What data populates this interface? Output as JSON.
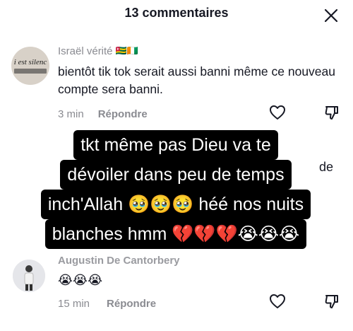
{
  "header": {
    "title": "13 commentaires",
    "close_icon": "close-icon"
  },
  "comments": [
    {
      "avatar_text": "i est silenc",
      "username": "Israël vérité",
      "flags": "🇹🇬🇨🇮",
      "text": "bientôt tik tok serait aussi banni même ce nouveau compte sera banni.",
      "time": "3 min",
      "reply_label": "Répondre"
    },
    {
      "username": "Augustin De Cantorbery",
      "text": "😭😭😭",
      "time": "15 min",
      "reply_label": "Répondre"
    }
  ],
  "hidden_snippet": "de",
  "overlay": {
    "lines": [
      "tkt même pas Dieu va te",
      "dévoiler dans peu de temps",
      "inch'Allah 🥹🥹🥹 héé nos nuits",
      "blanches hmm 💔💔💔😭😭😭"
    ]
  },
  "colors": {
    "text_primary": "#161823",
    "text_secondary": "#8a8b91",
    "overlay_bg": "#000000",
    "overlay_text": "#ffffff"
  }
}
